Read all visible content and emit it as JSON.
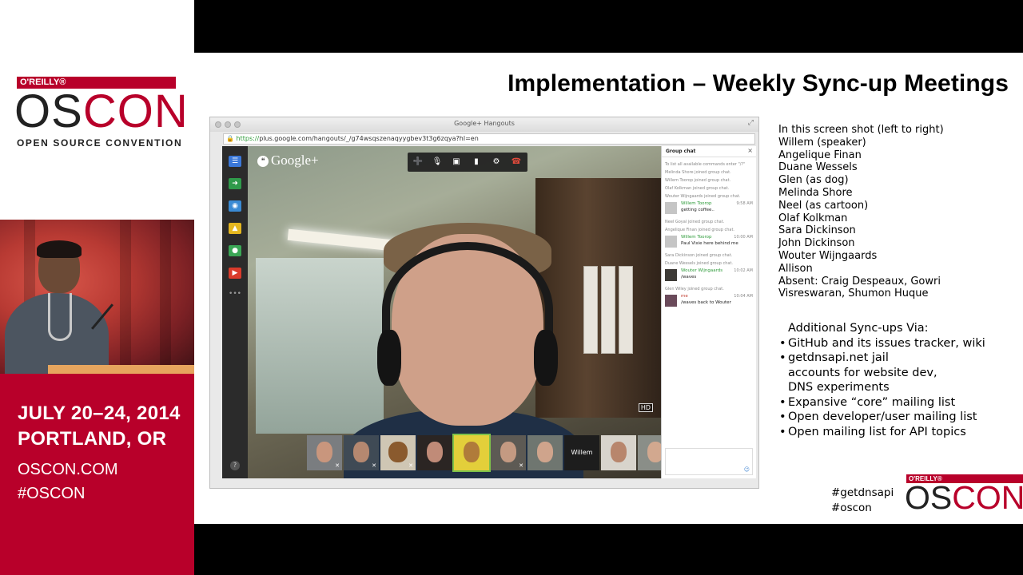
{
  "branding": {
    "publisher": "O'REILLY®",
    "logo_os": "OS",
    "logo_con": "CON",
    "subtitle": "OPEN SOURCE CONVENTION"
  },
  "event": {
    "dates": "JULY 20–24, 2014",
    "city": "PORTLAND, OR",
    "website": "OSCON.COM",
    "hashtag": "#OSCON"
  },
  "slide": {
    "title": "Implementation – Weekly Sync-up Meetings",
    "attendees_intro": "In this screen shot (left to right)",
    "attendees": [
      "Willem (speaker)",
      "Angelique Finan",
      "Duane Wessels",
      "Glen (as dog)",
      "Melinda Shore",
      "Neel (as cartoon)",
      "Olaf Kolkman",
      "Sara Dickinson",
      "John Dickinson",
      "Wouter Wijngaards",
      "Allison",
      "Absent: Craig Despeaux, Gowri",
      "Visreswaran, Shumon Huque"
    ],
    "additional_heading": "Additional Sync-ups Via:",
    "additional_items": [
      "GitHub and its issues tracker, wiki",
      "getdnsapi.net jail",
      "accounts for website dev,",
      "DNS experiments",
      "Expansive “core” mailing list",
      "Open developer/user mailing list",
      "Open mailing list for API topics"
    ],
    "hashtags": [
      "#getdnsapi",
      "#oscon"
    ],
    "footer_publisher": "O'REILLY®",
    "footer_logo_os": "OS",
    "footer_logo_con": "CON"
  },
  "hangout": {
    "window_title": "Google+ Hangouts",
    "url_scheme": "https://",
    "url_rest": "plus.google.com/hangouts/_/g74wsqszenaqyygbev3t3g6zqya?hl=en",
    "brand": "Google+",
    "hd_label": "HD",
    "filmstrip_named_label": "Willem",
    "chat": {
      "header": "Group chat",
      "close": "×",
      "entries": [
        {
          "kind": "sys",
          "text": "To list all available commands enter \"/?\""
        },
        {
          "kind": "sys",
          "text": "Melinda Shore joined group chat."
        },
        {
          "kind": "sys",
          "text": "Willem Toorop joined group chat."
        },
        {
          "kind": "sys",
          "text": "Olaf Kolkman joined group chat."
        },
        {
          "kind": "sys",
          "text": "Wouter Wijngaards joined group chat."
        },
        {
          "kind": "msg",
          "name": "Willem Toorop",
          "text": "getting coffee..",
          "time": "9:58 AM"
        },
        {
          "kind": "sys",
          "text": "Neel Goyal joined group chat."
        },
        {
          "kind": "sys",
          "text": "Angelique Finan joined group chat."
        },
        {
          "kind": "msg",
          "name": "Willem Toorop",
          "text": "Paul Vixie here behind me",
          "time": "10:00 AM"
        },
        {
          "kind": "sys",
          "text": "Sara Dickinson joined group chat."
        },
        {
          "kind": "sys",
          "text": "Duane Wessels joined group chat."
        },
        {
          "kind": "msg",
          "name": "Wouter Wijngaards",
          "text": "/waves",
          "time": "10:02 AM"
        },
        {
          "kind": "sys",
          "text": "Glen Wiley joined group chat."
        },
        {
          "kind": "msg",
          "name": "me",
          "text": "/waves back to Wouter",
          "time": "10:04 AM",
          "self": true
        }
      ]
    }
  },
  "colors": {
    "brand_red": "#b8002a",
    "chat_name_green": "#2e9b3a"
  },
  "icons": [
    "chat-icon",
    "share-icon",
    "camera-icon",
    "photo-icon",
    "chrome-icon",
    "youtube-icon",
    "more-icon",
    "invite-icon",
    "mic-off-icon",
    "camera-off-icon",
    "signal-icon",
    "settings-icon",
    "hangup-icon",
    "help-icon",
    "emoji-icon"
  ]
}
